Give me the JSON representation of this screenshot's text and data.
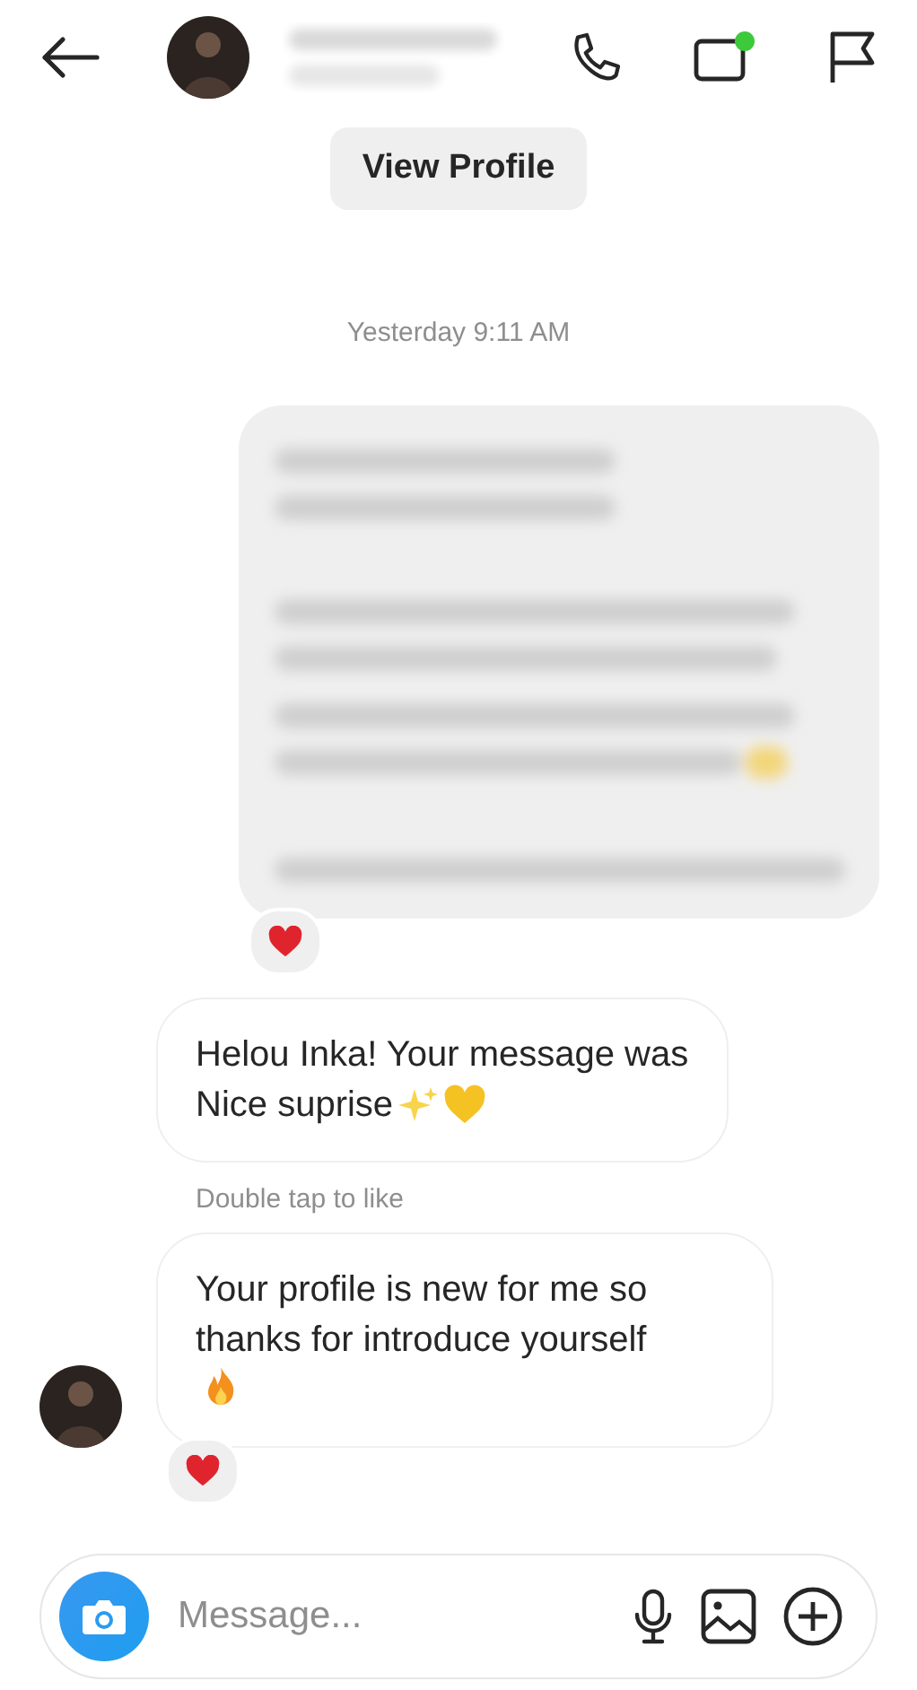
{
  "header": {
    "video_online": true
  },
  "profile_button": "View Profile",
  "timestamp": "Yesterday 9:11 AM",
  "messages": [
    {
      "kind": "blurred",
      "reacted": true
    },
    {
      "kind": "text",
      "lines": [
        "Helou Inka! Your message was",
        "Nice suprise"
      ],
      "emoji": [
        {
          "kind": "sparkles"
        },
        {
          "kind": "yellow_heart"
        }
      ],
      "reacted": false,
      "avatar": false,
      "emoji_on_new_line": false,
      "hint": "Double tap to like"
    },
    {
      "kind": "text",
      "text": "Your profile is new for me so thanks for introduce yourself",
      "emoji": [
        {
          "kind": "fire"
        }
      ],
      "reacted": true,
      "avatar": true,
      "emoji_on_new_line": true
    }
  ],
  "composer": {
    "placeholder": "Message..."
  }
}
